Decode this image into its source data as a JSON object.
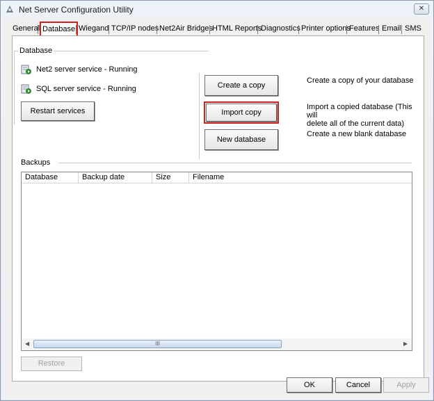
{
  "window": {
    "title": "Net Server Configuration Utility",
    "close_label": "✕"
  },
  "tabs": [
    {
      "label": "General"
    },
    {
      "label": "Database",
      "active": true
    },
    {
      "label": "Wiegand"
    },
    {
      "label": "TCP/IP nodes"
    },
    {
      "label": "Net2Air Bridges"
    },
    {
      "label": "HTML Reports"
    },
    {
      "label": "Diagnostics"
    },
    {
      "label": "Printer options"
    },
    {
      "label": "Features"
    },
    {
      "label": "Email"
    },
    {
      "label": "SMS"
    }
  ],
  "database_group": {
    "label": "Database",
    "services": [
      {
        "text": "Net2 server service - Running",
        "icon": "service-running-icon"
      },
      {
        "text": "SQL server service - Running",
        "icon": "service-running-icon"
      }
    ],
    "restart_label": "Restart services",
    "create_copy_label": "Create a copy",
    "create_copy_desc": "Create a copy of your database",
    "import_copy_label": "Import copy",
    "import_copy_desc_1": "Import a copied database (This will",
    "import_copy_desc_2": "delete all of the current data)",
    "new_database_label": "New database",
    "new_database_desc": "Create a new blank database"
  },
  "backups_group": {
    "label": "Backups",
    "columns": [
      "Database",
      "Backup date",
      "Size",
      "Filename"
    ],
    "rows": [],
    "scroll_grip": "III",
    "restore_label": "Restore"
  },
  "footer": {
    "ok_label": "OK",
    "cancel_label": "Cancel",
    "apply_label": "Apply"
  },
  "colors": {
    "highlight": "#d02020",
    "service_icon": "#2e8b2e"
  }
}
